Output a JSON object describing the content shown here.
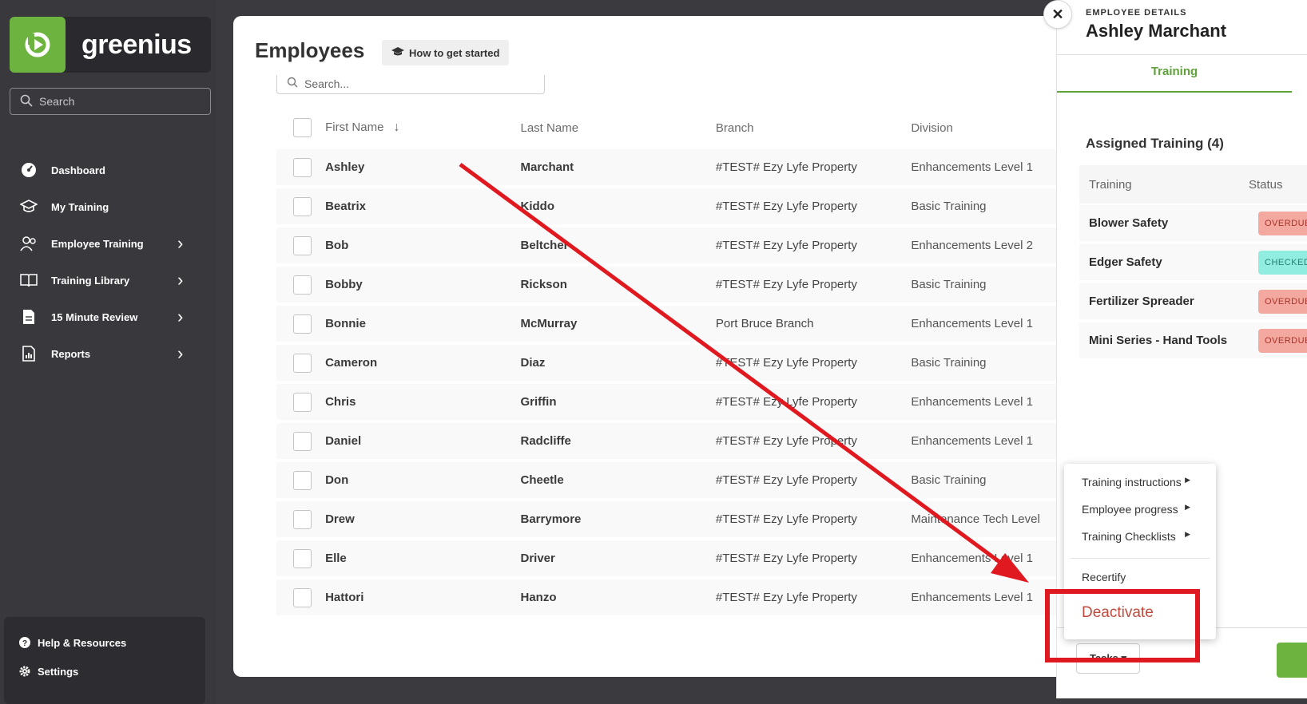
{
  "app": {
    "logo_text": "greenius",
    "brand_color": "#6cb43f"
  },
  "sidebar": {
    "search_placeholder": "Search",
    "items": [
      {
        "label": "Dashboard",
        "icon": "dashboard-icon",
        "has_chevron": false
      },
      {
        "label": "My Training",
        "icon": "graduation-cap-icon",
        "has_chevron": false
      },
      {
        "label": "Employee Training",
        "icon": "users-icon",
        "has_chevron": true
      },
      {
        "label": "Training Library",
        "icon": "book-icon",
        "has_chevron": true
      },
      {
        "label": "15 Minute Review",
        "icon": "document-icon",
        "has_chevron": true
      },
      {
        "label": "Reports",
        "icon": "report-icon",
        "has_chevron": true
      }
    ],
    "bottom": [
      {
        "label": "Help & Resources",
        "icon": "help-icon"
      },
      {
        "label": "Settings",
        "icon": "gear-icon"
      }
    ]
  },
  "main": {
    "title": "Employees",
    "how_to_label": "How to get started",
    "search_placeholder": "Search...",
    "columns": [
      "First Name",
      "Last Name",
      "Branch",
      "Division"
    ],
    "rows": [
      {
        "first": "Ashley",
        "last": "Marchant",
        "branch": "#TEST# Ezy Lyfe Property",
        "division": "Enhancements Level 1"
      },
      {
        "first": "Beatrix",
        "last": "Kiddo",
        "branch": "#TEST# Ezy Lyfe Property",
        "division": "Basic Training"
      },
      {
        "first": "Bob",
        "last": "Beltcher",
        "branch": "#TEST# Ezy Lyfe Property",
        "division": "Enhancements Level 2"
      },
      {
        "first": "Bobby",
        "last": "Rickson",
        "branch": "#TEST# Ezy Lyfe Property",
        "division": "Basic Training"
      },
      {
        "first": "Bonnie",
        "last": "McMurray",
        "branch": "Port Bruce Branch",
        "division": "Enhancements Level 1"
      },
      {
        "first": "Cameron",
        "last": "Diaz",
        "branch": "#TEST# Ezy Lyfe Property",
        "division": "Basic Training"
      },
      {
        "first": "Chris",
        "last": "Griffin",
        "branch": "#TEST# Ezy Lyfe Property",
        "division": "Enhancements Level 1"
      },
      {
        "first": "Daniel",
        "last": "Radcliffe",
        "branch": "#TEST# Ezy Lyfe Property",
        "division": "Enhancements Level 1"
      },
      {
        "first": "Don",
        "last": "Cheetle",
        "branch": "#TEST# Ezy Lyfe Property",
        "division": "Basic Training"
      },
      {
        "first": "Drew",
        "last": "Barrymore",
        "branch": "#TEST# Ezy Lyfe Property",
        "division": "Maintenance Tech Level"
      },
      {
        "first": "Elle",
        "last": "Driver",
        "branch": "#TEST# Ezy Lyfe Property",
        "division": "Enhancements Level 1"
      },
      {
        "first": "Hattori",
        "last": "Hanzo",
        "branch": "#TEST# Ezy Lyfe Property",
        "division": "Enhancements Level 1"
      }
    ]
  },
  "panel": {
    "label": "EMPLOYEE DETAILS",
    "name": "Ashley Marchant",
    "tab": "Training",
    "assigned_title": "Assigned Training (4)",
    "table_headers": [
      "Training",
      "Status"
    ],
    "trainings": [
      {
        "name": "Blower Safety",
        "status": "OVERDUE",
        "status_color": "#f3a99f"
      },
      {
        "name": "Edger Safety",
        "status": "CHECKED",
        "status_color": "#90eddf"
      },
      {
        "name": "Fertilizer Spreader",
        "status": "OVERDUE",
        "status_color": "#f3a99f"
      },
      {
        "name": "Mini Series - Hand Tools",
        "status": "OVERDUE",
        "status_color": "#f3a99f"
      }
    ],
    "tasks_label": "Tasks"
  },
  "dropdown": {
    "items": [
      "Training instructions",
      "Employee progress",
      "Training Checklists"
    ],
    "recertify": "Recertify",
    "deactivate": "Deactivate",
    "deactivate_color": "#c04a3c"
  },
  "annotation": {
    "color": "#e0181f"
  }
}
